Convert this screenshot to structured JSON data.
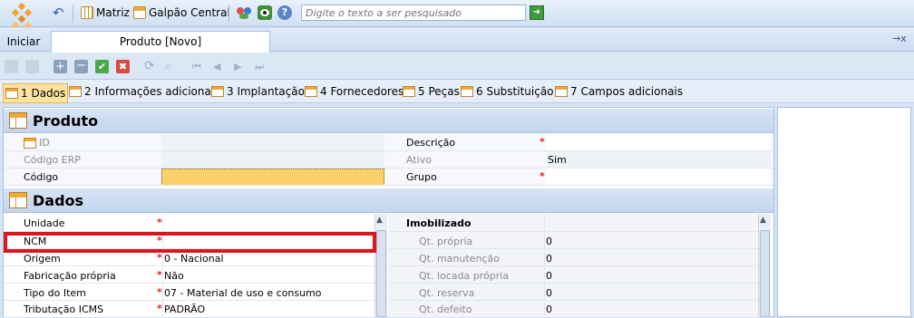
{
  "toolbar": {
    "items": [
      {
        "label": "Matriz"
      },
      {
        "label": "Galpão Central"
      }
    ],
    "search_placeholder": "Digite o texto a ser pesquisado"
  },
  "tabs": {
    "home": "Iniciar",
    "active": "Produto [Novo]",
    "close_glyph": "→x"
  },
  "sections": [
    {
      "label": "1 Dados"
    },
    {
      "label": "2 Informações adicionais"
    },
    {
      "label": "3 Implantação"
    },
    {
      "label": "4 Fornecedores"
    },
    {
      "label": "5 Peças"
    },
    {
      "label": "6 Substituição"
    },
    {
      "label": "7 Campos adicionais"
    }
  ],
  "produto": {
    "title": "Produto",
    "left": [
      {
        "label": "ID",
        "value": ""
      },
      {
        "label": "Código ERP",
        "value": ""
      },
      {
        "label": "Código",
        "value": ""
      }
    ],
    "right": [
      {
        "label": "Descrição",
        "value": ""
      },
      {
        "label": "Ativo",
        "value": "Sim"
      },
      {
        "label": "Grupo",
        "value": ""
      }
    ]
  },
  "dados": {
    "title": "Dados",
    "left": [
      {
        "label": "Unidade",
        "value": ""
      },
      {
        "label": "NCM",
        "value": ""
      },
      {
        "label": "Origem",
        "value": "0 - Nacional"
      },
      {
        "label": "Fabricação própria",
        "value": "Não"
      },
      {
        "label": "Tipo do Item",
        "value": "07 - Material de uso e consumo"
      },
      {
        "label": "Tributação ICMS",
        "value": "PADRÃO"
      }
    ],
    "right_header": "Imobilizado",
    "right": [
      {
        "label": "Qt. própria",
        "value": "0"
      },
      {
        "label": "Qt. manutenção",
        "value": "0"
      },
      {
        "label": "Qt. locada própria",
        "value": "0"
      },
      {
        "label": "Qt. reserva",
        "value": "0"
      },
      {
        "label": "Qt. defeito",
        "value": "0"
      }
    ]
  },
  "required_mark": "*"
}
